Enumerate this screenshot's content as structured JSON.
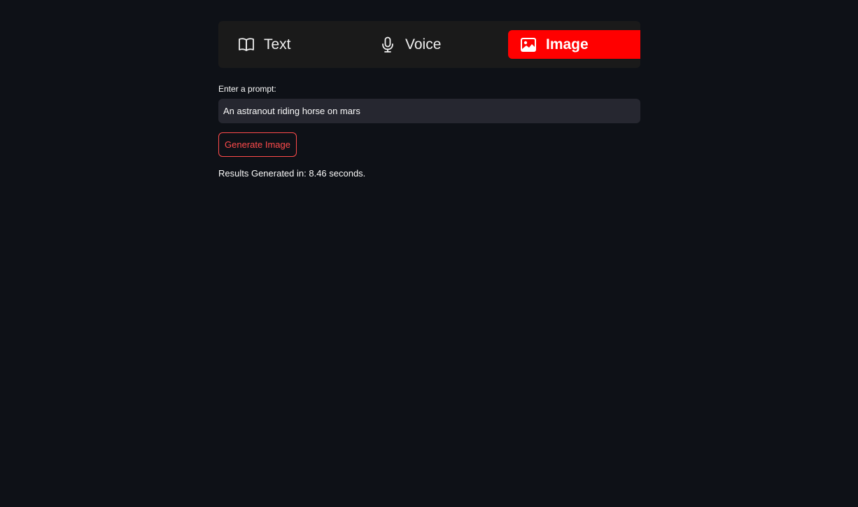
{
  "nav": {
    "tabs": [
      {
        "label": "Text",
        "icon": "book-icon"
      },
      {
        "label": "Voice",
        "icon": "microphone-icon"
      },
      {
        "label": "Image",
        "icon": "image-icon"
      }
    ],
    "active_tab": "Image",
    "active_color": "#ff0000"
  },
  "form": {
    "prompt_label": "Enter a prompt:",
    "prompt_value": "An astranout riding horse on mars",
    "generate_label": "Generate Image"
  },
  "result": {
    "text": "Results Generated in: 8.46 seconds."
  },
  "colors": {
    "background": "#0e1117",
    "accent": "#ff4b4b"
  }
}
